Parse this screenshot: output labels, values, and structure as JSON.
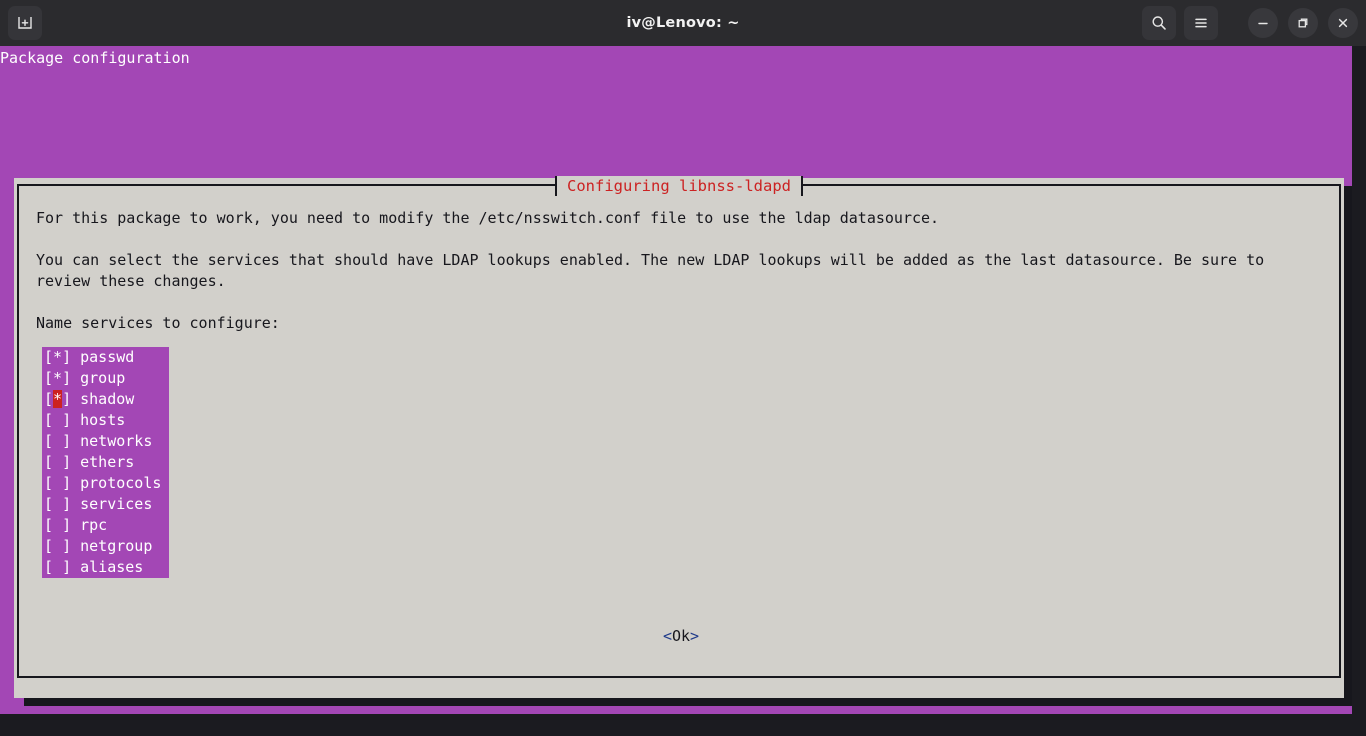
{
  "titlebar": {
    "title": "iv@Lenovo: ~",
    "new_tab_icon": "new-tab-icon",
    "search_icon": "search-icon",
    "menu_icon": "hamburger-menu-icon",
    "minimize_icon": "minimize-icon",
    "maximize_icon": "maximize-restore-icon",
    "close_icon": "close-icon"
  },
  "terminal": {
    "header_line": "Package configuration",
    "background_color": "#a347b5",
    "foreground_color": "#ffffff"
  },
  "dialog": {
    "title": "Configuring libnss-ldapd",
    "title_color": "#cc2222",
    "background_color": "#d2d0cb",
    "border_color": "#17171d",
    "paragraphs": [
      "For this package to work, you need to modify the /etc/nsswitch.conf file to use the ldap datasource.",
      "You can select the services that should have LDAP lookups enabled. The new LDAP lookups will be added as the last datasource. Be sure to review these changes.",
      "Name services to configure:"
    ],
    "checklist": {
      "highlight_color": "#a347b5",
      "cursor_color": "#cc2222",
      "items": [
        {
          "checked": true,
          "label": "passwd",
          "cursor": false
        },
        {
          "checked": true,
          "label": "group",
          "cursor": false
        },
        {
          "checked": true,
          "label": "shadow",
          "cursor": true
        },
        {
          "checked": false,
          "label": "hosts",
          "cursor": false
        },
        {
          "checked": false,
          "label": "networks",
          "cursor": false
        },
        {
          "checked": false,
          "label": "ethers",
          "cursor": false
        },
        {
          "checked": false,
          "label": "protocols",
          "cursor": false
        },
        {
          "checked": false,
          "label": "services",
          "cursor": false
        },
        {
          "checked": false,
          "label": "rpc",
          "cursor": false
        },
        {
          "checked": false,
          "label": "netgroup",
          "cursor": false
        },
        {
          "checked": false,
          "label": "aliases",
          "cursor": false
        }
      ]
    },
    "ok_button": {
      "open_bracket": "<",
      "label": "Ok",
      "close_bracket": ">",
      "bracket_color": "#1f3a8a"
    }
  }
}
